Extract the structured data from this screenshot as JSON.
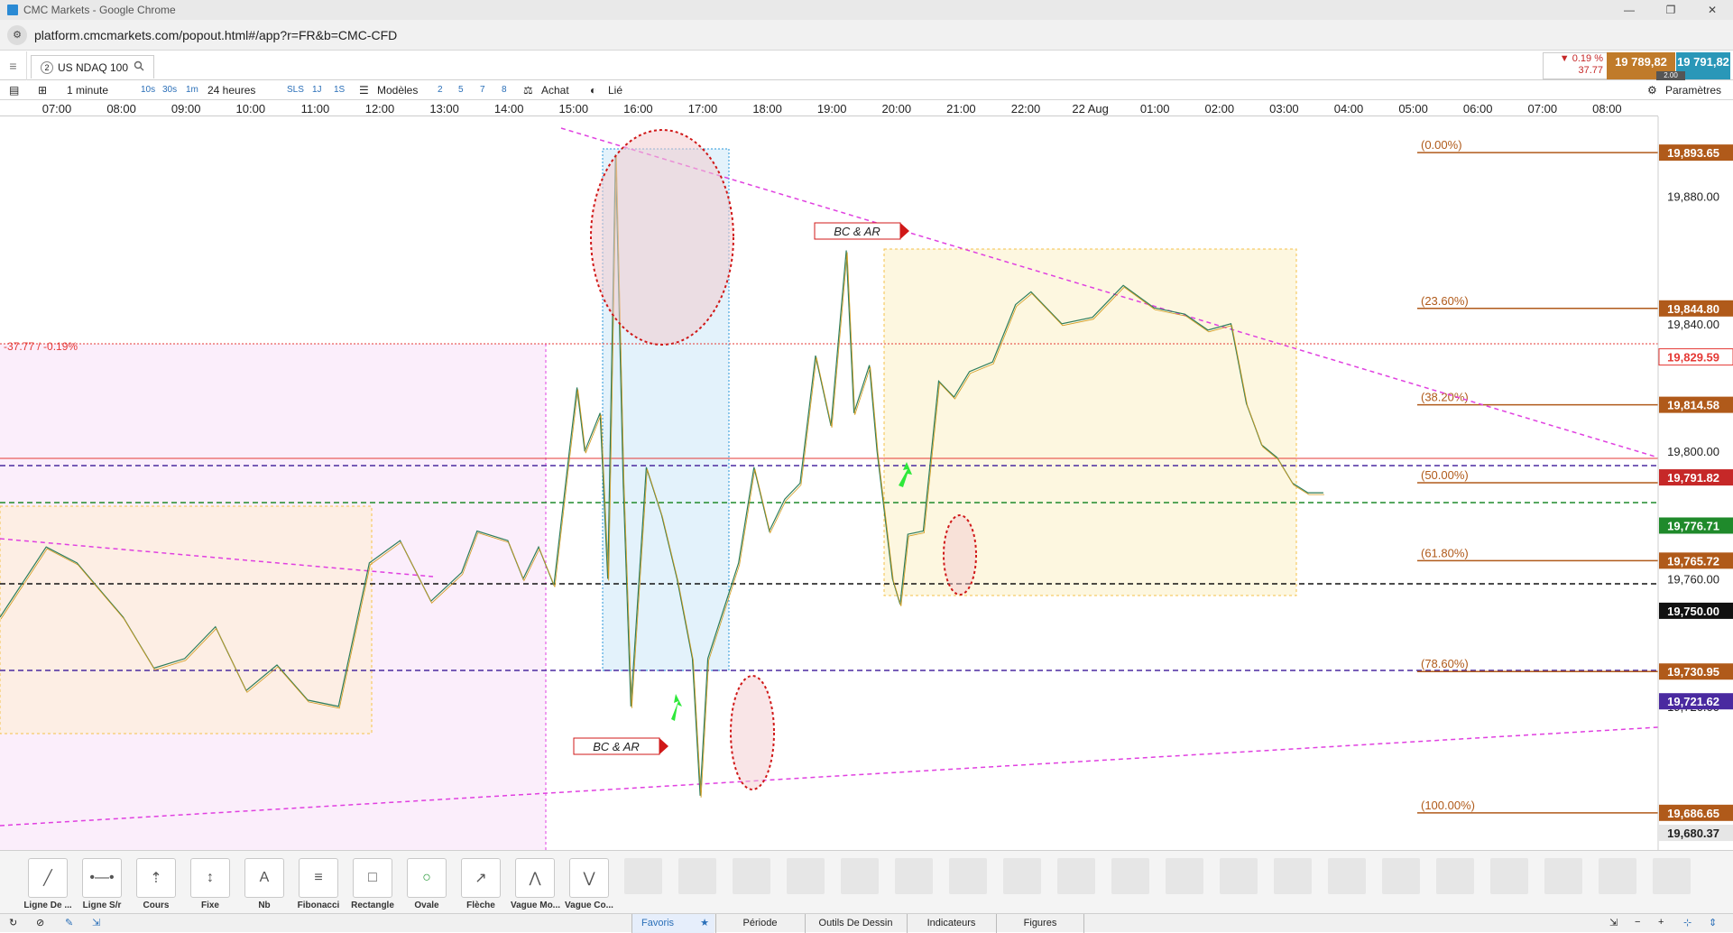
{
  "window": {
    "title": "CMC Markets - Google Chrome",
    "minimize": "—",
    "restore": "❐",
    "close": "✕"
  },
  "address": {
    "url": "platform.cmcmarkets.com/popout.html#/app?r=FR&b=CMC-CFD"
  },
  "instrument": {
    "tab_number": "2",
    "name": "US NDAQ 100",
    "change_pct": "▼ 0.19 %",
    "change_pts": "37.77",
    "sell": "19 789,82",
    "buy": "19 791,82",
    "spread": "2.00"
  },
  "toolbar": {
    "interval": "1 minute",
    "tf_10s": "10s",
    "tf_30s": "30s",
    "tf_1m": "1m",
    "range": "24 heures",
    "sls": "SLS",
    "one_j": "1J",
    "one_s": "1S",
    "models": "Modèles",
    "n2": "2",
    "n5": "5",
    "n7": "7",
    "n8": "8",
    "buy": "Achat",
    "linked": "Lié",
    "settings": "Paramètres"
  },
  "time_axis": [
    "07:00",
    "08:00",
    "09:00",
    "10:00",
    "11:00",
    "12:00",
    "13:00",
    "14:00",
    "15:00",
    "16:00",
    "17:00",
    "18:00",
    "19:00",
    "20:00",
    "21:00",
    "22:00",
    "22 Aug",
    "01:00",
    "02:00",
    "03:00",
    "04:00",
    "05:00",
    "06:00",
    "07:00",
    "08:00"
  ],
  "price_axis": {
    "ticks": [
      "19,880.00",
      "19,840.00",
      "19,800.00",
      "19,760.00",
      "19,720.00"
    ],
    "markers": [
      {
        "label": "19,893.65",
        "color": "#b05a1a"
      },
      {
        "label": "19,844.80",
        "color": "#b05a1a"
      },
      {
        "label": "19,829.59",
        "color": "#e53935"
      },
      {
        "label": "19,814.58",
        "color": "#b05a1a"
      },
      {
        "label": "19,791.82",
        "color": "#c62828"
      },
      {
        "label": "19,776.71",
        "color": "#1f8a2b"
      },
      {
        "label": "19,765.72",
        "color": "#b05a1a"
      },
      {
        "label": "19,750.00",
        "color": "#111111"
      },
      {
        "label": "19,730.95",
        "color": "#b05a1a"
      },
      {
        "label": "19,721.62",
        "color": "#4a2aa0"
      },
      {
        "label": "19,686.65",
        "color": "#b05a1a"
      },
      {
        "label": "19,680.37",
        "color": "#333333"
      }
    ]
  },
  "chart": {
    "prev_close_label": "-37.77 / -0.19%",
    "fib_levels": [
      "(0.00%)",
      "(23.60%)",
      "(38.20%)",
      "(50.00%)",
      "(61.80%)",
      "(78.60%)",
      "(100.00%)"
    ],
    "annotations": [
      "BC & AR",
      "BC & AR"
    ]
  },
  "drawing_tools": [
    "Ligne De ...",
    "Ligne S/r",
    "Cours",
    "Fixe",
    "Nb",
    "Fibonacci",
    "Rectangle",
    "Ovale",
    "Flèche",
    "Vague Mo...",
    "Vague Co..."
  ],
  "status": {
    "favorites": "Favoris",
    "period": "Période",
    "drawing": "Outils De Dessin",
    "indicators": "Indicateurs",
    "figures": "Figures"
  },
  "chart_data": {
    "type": "line",
    "title": "",
    "xlabel": "",
    "ylabel": "",
    "ylim": [
      19675,
      19905
    ],
    "series": [
      {
        "values": [
          [
            0,
            19748
          ],
          [
            0.03,
            19770
          ],
          [
            0.05,
            19765
          ],
          [
            0.08,
            19748
          ],
          [
            0.1,
            19732
          ],
          [
            0.12,
            19735
          ],
          [
            0.14,
            19745
          ],
          [
            0.16,
            19725
          ],
          [
            0.18,
            19733
          ],
          [
            0.2,
            19722
          ],
          [
            0.22,
            19720
          ],
          [
            0.24,
            19765
          ],
          [
            0.26,
            19772
          ],
          [
            0.28,
            19753
          ],
          [
            0.3,
            19762
          ],
          [
            0.31,
            19775
          ],
          [
            0.33,
            19772
          ],
          [
            0.34,
            19760
          ],
          [
            0.35,
            19770
          ],
          [
            0.36,
            19758
          ],
          [
            0.37,
            19800
          ],
          [
            0.375,
            19820
          ],
          [
            0.38,
            19800
          ],
          [
            0.39,
            19812
          ],
          [
            0.395,
            19760
          ],
          [
            0.4,
            19893
          ],
          [
            0.405,
            19790
          ],
          [
            0.41,
            19720
          ],
          [
            0.42,
            19795
          ],
          [
            0.43,
            19780
          ],
          [
            0.44,
            19760
          ],
          [
            0.45,
            19735
          ],
          [
            0.455,
            19692
          ],
          [
            0.46,
            19735
          ],
          [
            0.48,
            19765
          ],
          [
            0.49,
            19795
          ],
          [
            0.5,
            19775
          ],
          [
            0.51,
            19785
          ],
          [
            0.52,
            19790
          ],
          [
            0.53,
            19830
          ],
          [
            0.54,
            19808
          ],
          [
            0.55,
            19863
          ],
          [
            0.555,
            19812
          ],
          [
            0.565,
            19827
          ],
          [
            0.57,
            19800
          ],
          [
            0.58,
            19760
          ],
          [
            0.585,
            19752
          ],
          [
            0.59,
            19774
          ],
          [
            0.6,
            19775
          ],
          [
            0.61,
            19822
          ],
          [
            0.62,
            19817
          ],
          [
            0.63,
            19825
          ],
          [
            0.645,
            19828
          ],
          [
            0.66,
            19846
          ],
          [
            0.67,
            19850
          ],
          [
            0.69,
            19840
          ],
          [
            0.71,
            19842
          ],
          [
            0.73,
            19852
          ],
          [
            0.75,
            19845
          ],
          [
            0.77,
            19843
          ],
          [
            0.785,
            19838
          ],
          [
            0.8,
            19840
          ],
          [
            0.81,
            19815
          ],
          [
            0.82,
            19802
          ],
          [
            0.83,
            19798
          ],
          [
            0.84,
            19790
          ],
          [
            0.85,
            19787
          ],
          [
            0.86,
            19787
          ]
        ]
      }
    ]
  },
  "colors": {
    "fib": "#b05a1a",
    "sell": "#c07b2a",
    "buy": "#2a97b8",
    "trend": "#e040e0"
  }
}
